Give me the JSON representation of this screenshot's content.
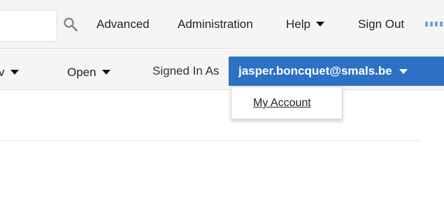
{
  "header": {
    "search": {
      "value": "",
      "placeholder": ""
    },
    "search_icon": "magnifier-icon",
    "links": {
      "advanced": "Advanced",
      "administration": "Administration",
      "help": "Help",
      "sign_out": "Sign Out"
    },
    "apps_icon": "app-grid-icon"
  },
  "toolbar": {
    "partial_menu_caret": "v",
    "open": "Open",
    "signed_in_as": "Signed In As",
    "user": "jasper.boncquet@smals.be"
  },
  "user_menu": {
    "items": [
      "My Account"
    ]
  },
  "colors": {
    "accent": "#2d71c4",
    "bar_background": "#f5f5f5",
    "apps_icon": "#6fa4dc"
  }
}
